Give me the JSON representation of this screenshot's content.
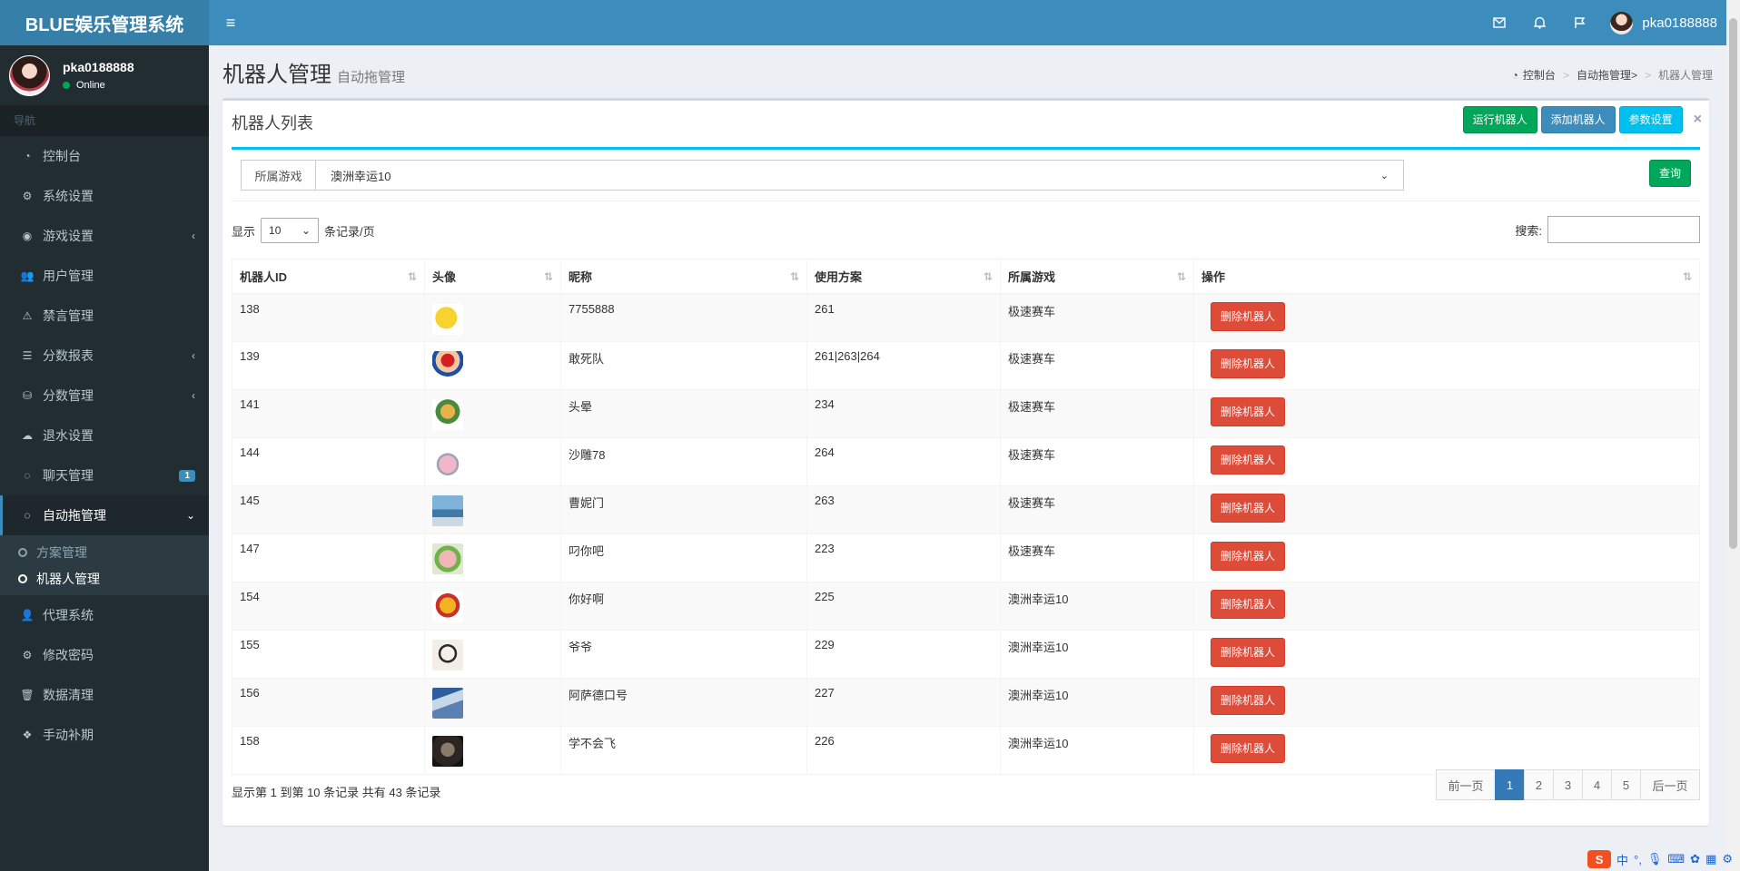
{
  "header": {
    "logo": "BLUE娱乐管理系统",
    "user_name": "pka0188888"
  },
  "sidebar": {
    "user": {
      "name": "pka0188888",
      "status": "Online"
    },
    "nav_header": "导航",
    "items": [
      {
        "label": "控制台",
        "icon": "dashboard-icon"
      },
      {
        "label": "系统设置",
        "icon": "cogs-icon"
      },
      {
        "label": "游戏设置",
        "icon": "gamepad-icon",
        "chevron": "‹"
      },
      {
        "label": "用户管理",
        "icon": "users-icon"
      },
      {
        "label": "禁言管理",
        "icon": "warning-icon"
      },
      {
        "label": "分数报表",
        "icon": "list-icon",
        "chevron": "‹"
      },
      {
        "label": "分数管理",
        "icon": "database-icon",
        "chevron": "‹"
      },
      {
        "label": "退水设置",
        "icon": "cloud-icon"
      },
      {
        "label": "聊天管理",
        "icon": "chat-icon",
        "badge": "1"
      },
      {
        "label": "自动拖管理",
        "icon": "comment-icon",
        "chevron": "⌄"
      },
      {
        "label": "代理系统",
        "icon": "user-plus-icon"
      },
      {
        "label": "修改密码",
        "icon": "gear-icon"
      },
      {
        "label": "数据清理",
        "icon": "trash-icon"
      },
      {
        "label": "手动补期",
        "icon": "cubes-icon"
      }
    ],
    "sub_items": [
      {
        "label": "方案管理"
      },
      {
        "label": "机器人管理"
      }
    ]
  },
  "page": {
    "title": "机器人管理",
    "subtitle": "自动拖管理",
    "breadcrumb": [
      "控制台",
      "自动拖管理>",
      "机器人管理"
    ]
  },
  "box": {
    "title": "机器人列表",
    "buttons": {
      "run": "运行机器人",
      "add": "添加机器人",
      "params": "参数设置"
    },
    "close": "×"
  },
  "filter": {
    "label": "所属游戏",
    "selected": "澳洲幸运10",
    "query": "查询"
  },
  "length": {
    "prefix": "显示",
    "value": "10",
    "suffix": "条记录/页"
  },
  "search": {
    "label": "搜索:"
  },
  "table": {
    "headers": [
      "机器人ID",
      "头像",
      "昵称",
      "使用方案",
      "所属游戏",
      "操作"
    ],
    "delete_label": "删除机器人",
    "rows": [
      {
        "id": "138",
        "name": "7755888",
        "plan": "261",
        "game": "极速赛车",
        "avatar": "pikachu"
      },
      {
        "id": "139",
        "name": "敢死队",
        "plan": "261|263|264",
        "game": "极速赛车",
        "avatar": "mario"
      },
      {
        "id": "141",
        "name": "头晕",
        "plan": "234",
        "game": "极速赛车",
        "avatar": "cartoon"
      },
      {
        "id": "144",
        "name": "沙雕78",
        "plan": "264",
        "game": "极速赛车",
        "avatar": "pink"
      },
      {
        "id": "145",
        "name": "曹妮门",
        "plan": "263",
        "game": "极速赛车",
        "avatar": "tower"
      },
      {
        "id": "147",
        "name": "叼你吧",
        "plan": "223",
        "game": "极速赛车",
        "avatar": "face"
      },
      {
        "id": "154",
        "name": "你好啊",
        "plan": "225",
        "game": "澳洲幸运10",
        "avatar": "pooh"
      },
      {
        "id": "155",
        "name": "爷爷",
        "plan": "229",
        "game": "澳洲幸运10",
        "avatar": "sketch"
      },
      {
        "id": "156",
        "name": "阿萨德口号",
        "plan": "227",
        "game": "澳洲幸运10",
        "avatar": "sky"
      },
      {
        "id": "158",
        "name": "学不会飞",
        "plan": "226",
        "game": "澳洲幸运10",
        "avatar": "dark"
      }
    ]
  },
  "footer": {
    "info": "显示第 1 到第 10 条记录 共有 43 条记录",
    "prev": "前一页",
    "next": "后一页",
    "pages": [
      "1",
      "2",
      "3",
      "4",
      "5"
    ]
  },
  "ime": {
    "logo": "S",
    "mode": "中"
  }
}
